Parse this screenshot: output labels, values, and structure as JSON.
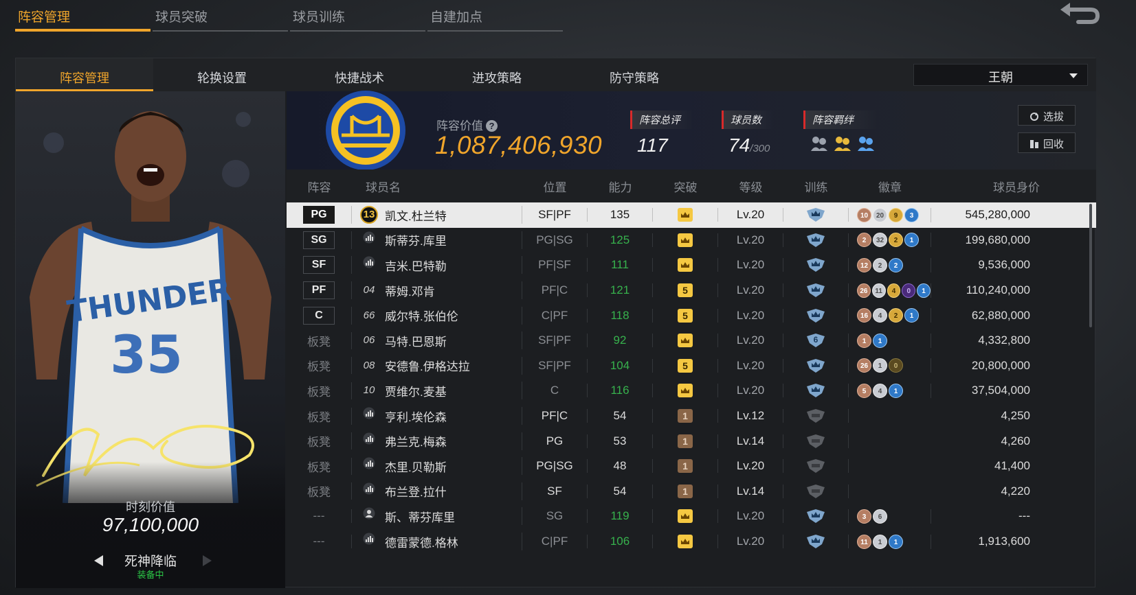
{
  "top_tabs": [
    "阵容管理",
    "球员突破",
    "球员训练",
    "自建加点"
  ],
  "sub_tabs": [
    "阵容管理",
    "轮换设置",
    "快捷战术",
    "进攻策略",
    "防守策略"
  ],
  "team_select": "王朝",
  "card": {
    "value_label": "时刻价值",
    "value": "97,100,000",
    "name": "死神降临",
    "equip_status": "装备中",
    "jersey_text": "THUNDER",
    "jersey_number": "35"
  },
  "stats": {
    "lineup_value_label": "阵容价值",
    "lineup_value": "1,087,406,930",
    "overall_label": "阵容总评",
    "overall": "117",
    "players_label": "球员数",
    "players": "74",
    "players_max": "/300",
    "bond_label": "阵容羁绊",
    "select_btn": "选拔",
    "recycle_btn": "回收"
  },
  "table_headers": [
    "阵容",
    "球员名",
    "位置",
    "能力",
    "突破",
    "等级",
    "训练",
    "徽章",
    "球员身价"
  ],
  "rows": [
    {
      "slot": "PG",
      "slot_type": "box",
      "num": "13",
      "num_type": "ring",
      "name": "凯文.杜兰特",
      "pos": "SF|PF",
      "ability": "135",
      "ability_color": "normal",
      "break": "crown",
      "level": "Lv.20",
      "train": "blue",
      "badges": [
        [
          "10",
          "bronze"
        ],
        [
          "20",
          "silver"
        ],
        [
          "9",
          "gold"
        ],
        [
          "3",
          "blue"
        ]
      ],
      "value": "545,280,000",
      "selected": true
    },
    {
      "slot": "SG",
      "slot_type": "box",
      "num": "",
      "num_type": "bars",
      "name": "斯蒂芬.库里",
      "pos": "PG|SG",
      "ability": "125",
      "ability_color": "green",
      "break": "crown",
      "level": "Lv.20",
      "train": "blue",
      "badges": [
        [
          "2",
          "bronze"
        ],
        [
          "32",
          "silver"
        ],
        [
          "2",
          "gold"
        ],
        [
          "1",
          "blue"
        ]
      ],
      "value": "199,680,000"
    },
    {
      "slot": "SF",
      "slot_type": "box",
      "num": "",
      "num_type": "bars",
      "name": "吉米.巴特勒",
      "pos": "PF|SF",
      "ability": "111",
      "ability_color": "green",
      "break": "crown",
      "level": "Lv.20",
      "train": "blue",
      "badges": [
        [
          "12",
          "bronze"
        ],
        [
          "2",
          "silver"
        ],
        [
          "2",
          "blue"
        ]
      ],
      "value": "9,536,000"
    },
    {
      "slot": "PF",
      "slot_type": "box",
      "num": "04",
      "num_type": "text",
      "name": "蒂姆.邓肯",
      "pos": "PF|C",
      "ability": "121",
      "ability_color": "green",
      "break": "5",
      "level": "Lv.20",
      "train": "blue",
      "badges": [
        [
          "26",
          "bronze"
        ],
        [
          "11",
          "silver"
        ],
        [
          "4",
          "gold"
        ],
        [
          "0",
          "purple"
        ],
        [
          "1",
          "blue"
        ]
      ],
      "value": "110,240,000"
    },
    {
      "slot": "C",
      "slot_type": "box",
      "num": "66",
      "num_type": "text",
      "name": "威尔特.张伯伦",
      "pos": "C|PF",
      "ability": "118",
      "ability_color": "green",
      "break": "5",
      "level": "Lv.20",
      "train": "blue",
      "badges": [
        [
          "16",
          "bronze"
        ],
        [
          "4",
          "silver"
        ],
        [
          "2",
          "gold"
        ],
        [
          "1",
          "blue"
        ]
      ],
      "value": "62,880,000"
    },
    {
      "slot": "板凳",
      "slot_type": "bench",
      "num": "06",
      "num_type": "text",
      "name": "马特.巴恩斯",
      "pos": "SF|PF",
      "ability": "92",
      "ability_color": "green",
      "break": "crown",
      "level": "Lv.20",
      "train": "6",
      "badges": [
        [
          "1",
          "bronze"
        ],
        [
          "1",
          "blue"
        ]
      ],
      "value": "4,332,800"
    },
    {
      "slot": "板凳",
      "slot_type": "bench",
      "num": "08",
      "num_type": "text",
      "name": "安德鲁.伊格达拉",
      "pos": "SF|PF",
      "ability": "104",
      "ability_color": "green",
      "break": "5",
      "level": "Lv.20",
      "train": "blue",
      "badges": [
        [
          "26",
          "bronze"
        ],
        [
          "1",
          "silver"
        ],
        [
          "0",
          "dark"
        ]
      ],
      "value": "20,800,000"
    },
    {
      "slot": "板凳",
      "slot_type": "bench",
      "num": "10",
      "num_type": "text",
      "name": "贾维尔.麦基",
      "pos": "C",
      "ability": "116",
      "ability_color": "green",
      "break": "crown",
      "level": "Lv.20",
      "train": "blue",
      "badges": [
        [
          "5",
          "bronze"
        ],
        [
          "4",
          "silver"
        ],
        [
          "1",
          "blue"
        ]
      ],
      "value": "37,504,000"
    },
    {
      "slot": "板凳",
      "slot_type": "bench",
      "num": "",
      "num_type": "bars",
      "name": "亨利.埃伦森",
      "pos": "PF|C",
      "ability": "54",
      "ability_color": "normal",
      "break": "1",
      "level": "Lv.12",
      "train": "gray",
      "badges": [],
      "value": "4,250"
    },
    {
      "slot": "板凳",
      "slot_type": "bench",
      "num": "",
      "num_type": "bars",
      "name": "弗兰克.梅森",
      "pos": "PG",
      "ability": "53",
      "ability_color": "normal",
      "break": "1",
      "level": "Lv.14",
      "train": "gray",
      "badges": [],
      "value": "4,260"
    },
    {
      "slot": "板凳",
      "slot_type": "bench",
      "num": "",
      "num_type": "bars",
      "name": "杰里.贝勒斯",
      "pos": "PG|SG",
      "ability": "48",
      "ability_color": "normal",
      "break": "1",
      "level": "Lv.20",
      "train": "gray",
      "badges": [],
      "value": "41,400"
    },
    {
      "slot": "板凳",
      "slot_type": "bench",
      "num": "",
      "num_type": "bars",
      "name": "布兰登.拉什",
      "pos": "SF",
      "ability": "54",
      "ability_color": "normal",
      "break": "1",
      "level": "Lv.14",
      "train": "gray",
      "badges": [],
      "value": "4,220"
    },
    {
      "slot": "---",
      "slot_type": "dash",
      "num": "",
      "num_type": "person",
      "name": "斯、蒂芬库里",
      "pos": "SG",
      "ability": "119",
      "ability_color": "green",
      "break": "crown",
      "level": "Lv.20",
      "train": "blue",
      "badges": [
        [
          "3",
          "bronze"
        ],
        [
          "6",
          "silver"
        ]
      ],
      "value": "---"
    },
    {
      "slot": "---",
      "slot_type": "dash",
      "num": "",
      "num_type": "bars",
      "name": "德雷蒙德.格林",
      "pos": "C|PF",
      "ability": "106",
      "ability_color": "green",
      "break": "crown",
      "level": "Lv.20",
      "train": "blue",
      "badges": [
        [
          "11",
          "bronze"
        ],
        [
          "1",
          "silver"
        ],
        [
          "1",
          "blue"
        ]
      ],
      "value": "1,913,600"
    }
  ],
  "colors": {
    "accent": "#f0a52b",
    "green": "#37b24d",
    "gold": "#f5c842",
    "blue": "#2f79c8"
  }
}
